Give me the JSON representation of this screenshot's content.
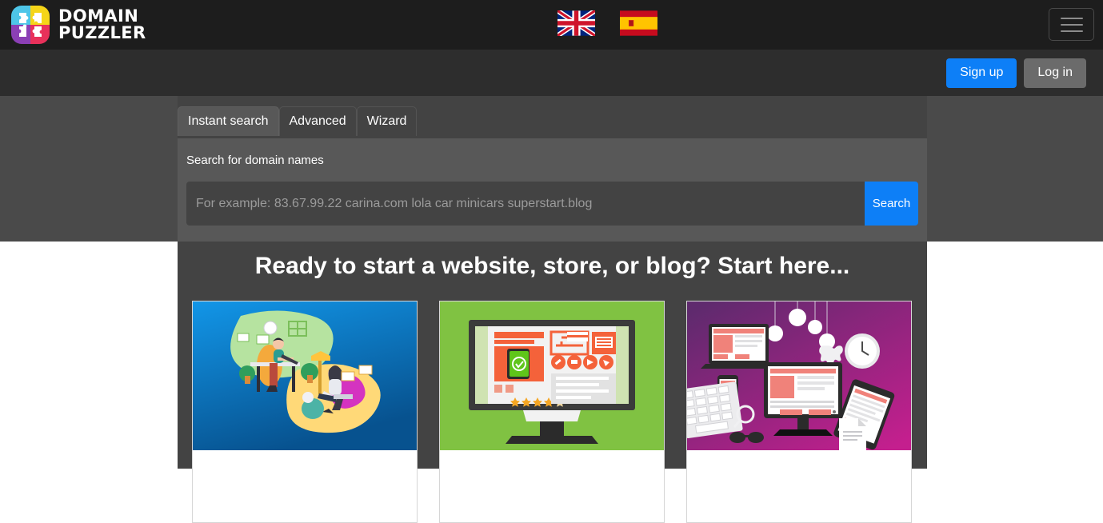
{
  "brand": {
    "line1": "DOMAIN",
    "line2": "PUZZLER",
    "logo_colors": {
      "top_left": "#4ec6e8",
      "top_right": "#f5d518",
      "bottom_left": "#8b3fb5",
      "bottom_right": "#e8315a"
    }
  },
  "header": {
    "languages": [
      {
        "name": "uk-flag",
        "label": "English"
      },
      {
        "name": "spain-flag",
        "label": "Espanol"
      }
    ],
    "menu_icon": "hamburger-menu-icon"
  },
  "auth": {
    "signup_label": "Sign up",
    "login_label": "Log in",
    "signup_color": "#0d7ff7",
    "login_color": "#6b6b6b"
  },
  "search": {
    "tabs": [
      {
        "label": "Instant search",
        "active": true
      },
      {
        "label": "Advanced",
        "active": false
      },
      {
        "label": "Wizard",
        "active": false
      }
    ],
    "label": "Search for domain names",
    "value": "",
    "placeholder": "For example: 83.67.99.22 carina.com lola car minicars superstart.blog",
    "button_label": "Search"
  },
  "promo": {
    "heading": "Ready to start a website, store, or blog? Start here...",
    "cards": [
      {
        "name": "card-website-builder",
        "image": "people-working-on-laptops-illustration",
        "bg": "#0a78c8"
      },
      {
        "name": "card-online-store",
        "image": "desktop-monitor-ecommerce-illustration",
        "bg": "#7cc142"
      },
      {
        "name": "card-devices",
        "image": "multi-device-web-design-illustration",
        "bg": "#8e2b86"
      }
    ]
  }
}
